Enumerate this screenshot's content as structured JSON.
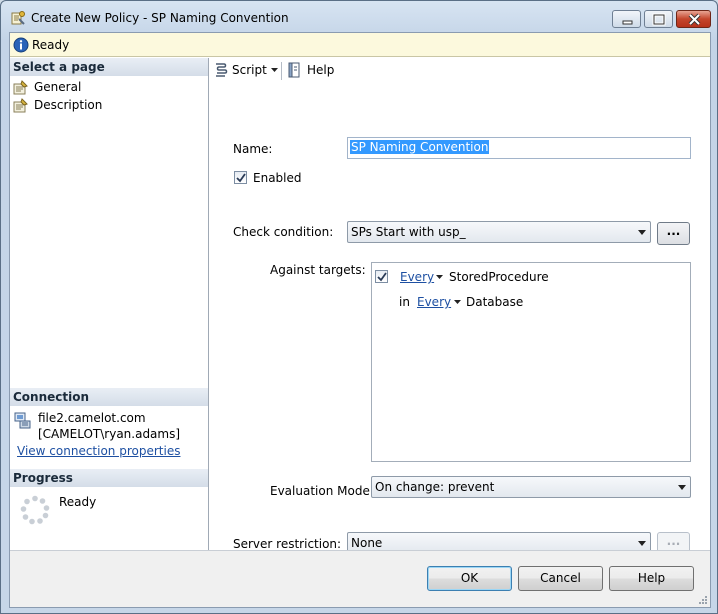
{
  "window": {
    "title": "Create New Policy - SP Naming Convention"
  },
  "status": {
    "text": "Ready"
  },
  "left": {
    "select_page_header": "Select a page",
    "pages": [
      {
        "label": "General"
      },
      {
        "label": "Description"
      }
    ],
    "connection_header": "Connection",
    "connection_server": "file2.camelot.com",
    "connection_user": "[CAMELOT\\ryan.adams]",
    "connection_link": "View connection properties",
    "progress_header": "Progress",
    "progress_text": "Ready"
  },
  "toolbar": {
    "script_label": "Script",
    "help_label": "Help"
  },
  "form": {
    "name_label": "Name:",
    "name_value": "SP Naming Convention",
    "enabled_label": "Enabled",
    "enabled_checked": true,
    "check_condition_label": "Check condition:",
    "check_condition_value": "SPs Start with usp_",
    "ellipsis": "...",
    "against_targets_label": "Against targets:",
    "targets": {
      "row1_quantifier": "Every",
      "row1_type": "StoredProcedure",
      "row2_prefix": "in",
      "row2_quantifier": "Every",
      "row2_type": "Database"
    },
    "evaluation_mode_label": "Evaluation Mode:",
    "evaluation_mode_value": "On change: prevent",
    "server_restriction_label": "Server restriction:",
    "server_restriction_value": "None"
  },
  "buttons": {
    "ok": "OK",
    "cancel": "Cancel",
    "help": "Help"
  }
}
